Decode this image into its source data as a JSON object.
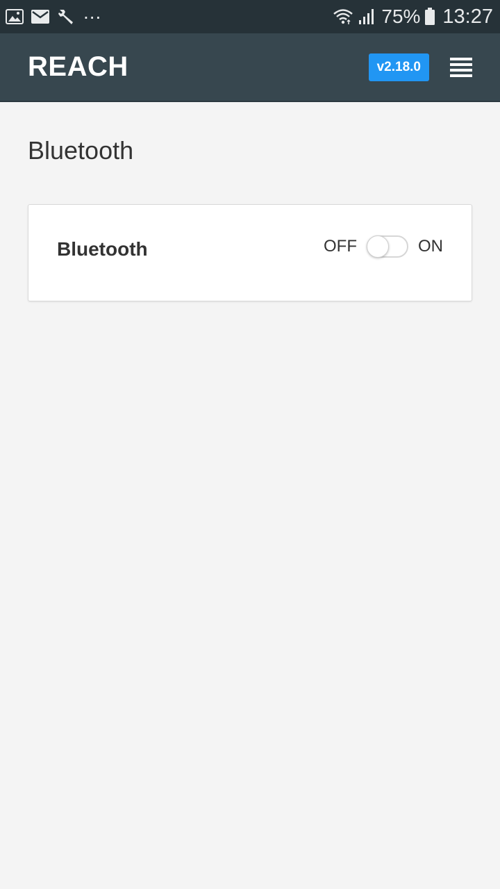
{
  "status_bar": {
    "left_icons": [
      "gallery-icon",
      "mail-icon",
      "wrench-icon"
    ],
    "more_indicator": "...",
    "right_icons": [
      "wifi-icon",
      "signal-icon",
      "battery-icon"
    ],
    "battery_percent": "75%",
    "time": "13:27"
  },
  "header": {
    "brand": "REACH",
    "version": "v2.18.0",
    "menu_icon": "hamburger-icon"
  },
  "page": {
    "title": "Bluetooth"
  },
  "bluetooth_card": {
    "label": "Bluetooth",
    "toggle": {
      "off_label": "OFF",
      "on_label": "ON",
      "state": "off"
    }
  },
  "colors": {
    "status_bar": "#263238",
    "header": "#37474f",
    "badge": "#2196f3",
    "background": "#f4f4f4"
  }
}
